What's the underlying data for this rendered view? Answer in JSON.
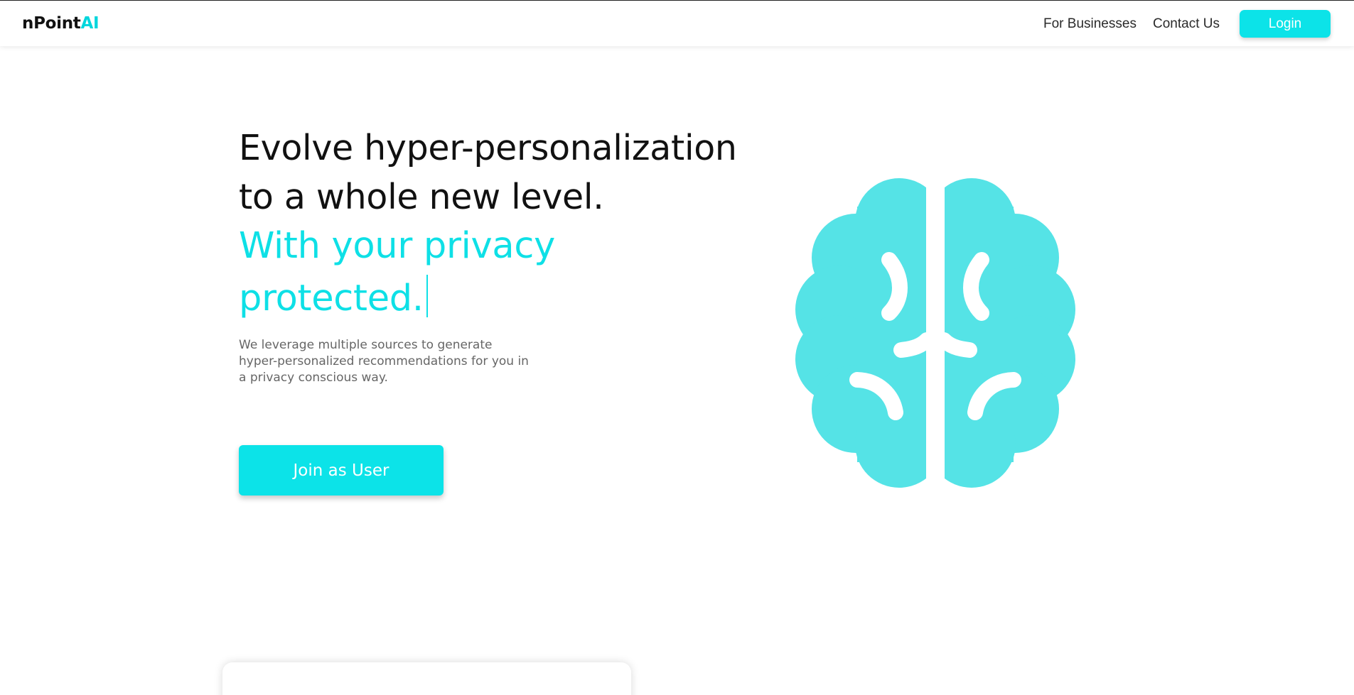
{
  "brand": {
    "name_main": "nPoint",
    "name_accent": "AI",
    "accent_color": "#0ce3e8"
  },
  "nav": {
    "links": [
      {
        "label": "For Businesses"
      },
      {
        "label": "Contact Us"
      }
    ],
    "login_label": "Login"
  },
  "hero": {
    "title_line1": "Evolve hyper-personalization",
    "title_line2": "to a whole new level.",
    "accent_line1": "With your privacy",
    "accent_line2": "protected.",
    "description": "We leverage multiple sources to generate hyper-personalized recommendations for you in a privacy conscious way.",
    "cta_label": "Join as User",
    "illustration_icon": "brain-icon"
  }
}
